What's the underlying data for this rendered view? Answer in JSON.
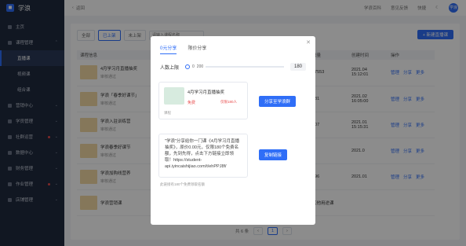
{
  "brand": {
    "name": "学浪"
  },
  "sidebar": {
    "items": [
      {
        "label": "主页"
      },
      {
        "label": "课程管理"
      },
      {
        "label": "直播课"
      },
      {
        "label": "视频课"
      },
      {
        "label": "组合课"
      },
      {
        "label": "营销中心"
      },
      {
        "label": "学员管理"
      },
      {
        "label": "社群运营"
      },
      {
        "label": "数据中心"
      },
      {
        "label": "财务管理"
      },
      {
        "label": "作业管理"
      },
      {
        "label": "店铺管理"
      }
    ]
  },
  "topbar": {
    "back": "返回",
    "links": [
      "学浪百科",
      "意见反馈",
      "快捷"
    ],
    "user": "学浪"
  },
  "filters": {
    "all": "全部",
    "on": "已上架",
    "off": "未上架",
    "search_placeholder": "请输入课程名称",
    "add": "+ 新建直播课"
  },
  "table": {
    "headers": [
      "课程信息",
      "",
      "",
      "",
      "销量",
      "创建时间",
      "操作"
    ],
    "rows": [
      {
        "name": "4月学习月直播抽奖",
        "status": "审核通过",
        "sales": "17553",
        "date": "2021.04",
        "time": "15:12:01"
      },
      {
        "name": "学浪「春季好课节」",
        "status": "审核通过",
        "sales": "231",
        "date": "2021.02",
        "time": "16:05:00"
      },
      {
        "name": "学浪入驻训练营",
        "status": "审核通过",
        "sales": "907",
        "date": "2021.01",
        "time": "15:15:31"
      },
      {
        "name": "学浪春季好课节",
        "status": "审核通过",
        "sales": "",
        "date": "2021.0",
        "time": ""
      },
      {
        "name": "学浪加购线营养",
        "status": "审核通过",
        "sales": "396",
        "date": "2021.01",
        "time": ""
      },
      {
        "name": "学浪营销课",
        "status": "",
        "sales": "",
        "date": "",
        "time": ""
      }
    ],
    "ops": [
      "管理",
      "分享",
      "更多"
    ],
    "extra": "其他用途课"
  },
  "pager": {
    "total": "共 6 条",
    "page": "1"
  },
  "modal": {
    "tabs": [
      "0元分享",
      "限价分享"
    ],
    "limit_label": "人数上限",
    "limit_min": "0",
    "limit_max": "200",
    "limit_value": "180",
    "course_title": "4月学习月直播抽奖",
    "price": "免费",
    "price_note": "仅限180人",
    "tag": "课程",
    "qr_button": "分享至学浪群",
    "share_text": "\"学浪\"分享给你一门课《4月学习月直播抽奖》，原价0.00元，仅限180个免费名额，先到先得，点击下方链接立即领取！https://student-api.iyincaishijiao.com/t/ehPPJ8f/",
    "copy_button": "复制链接",
    "hint": "此链接有180个免费领取名额"
  }
}
